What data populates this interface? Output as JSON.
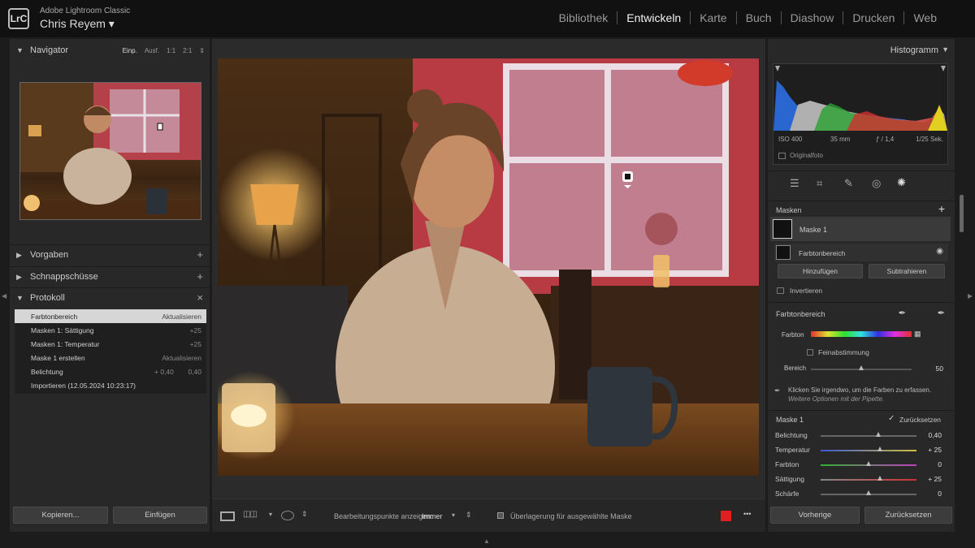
{
  "app": {
    "logo": "LrC",
    "name": "Adobe Lightroom Classic",
    "user": "Chris Reyem ▾"
  },
  "modules": [
    "Bibliothek",
    "Entwickeln",
    "Karte",
    "Buch",
    "Diashow",
    "Drucken",
    "Web"
  ],
  "active_module": "Entwickeln",
  "left": {
    "navigator": {
      "title": "Navigator",
      "zoom": [
        "Einp.",
        "Ausf.",
        "1:1",
        "2:1"
      ],
      "zoom_arrow": "⇕"
    },
    "vorgaben": {
      "title": "Vorgaben",
      "action": "+"
    },
    "schnappschuesse": {
      "title": "Schnappschüsse",
      "action": "+"
    },
    "protokoll": {
      "title": "Protokoll",
      "action": "×",
      "items": [
        {
          "name": "Farbtonbereich",
          "v1": "",
          "v2": "Aktualisieren"
        },
        {
          "name": "Masken 1: Sättigung",
          "v1": "",
          "v2": "+25"
        },
        {
          "name": "Masken 1: Temperatur",
          "v1": "",
          "v2": "+25"
        },
        {
          "name": "Maske 1 erstellen",
          "v1": "",
          "v2": "Aktualisieren"
        },
        {
          "name": "Belichtung",
          "v1": "+ 0,40",
          "v2": "0,40"
        },
        {
          "name": "Importieren (12.05.2024 10:23:17)",
          "v1": "",
          "v2": ""
        }
      ]
    },
    "copy_label": "Kopieren...",
    "paste_label": "Einfügen"
  },
  "toolbar": {
    "edit_points_label": "Bearbeitungspunkte anzeigen:",
    "edit_points_value": "Immer",
    "overlay_label": "Überlagerung für ausgewählte Maske",
    "overlay_color": "#e02020",
    "more": "•••"
  },
  "right": {
    "histogram": {
      "title": "Histogramm",
      "iso": "ISO 400",
      "focal": "35 mm",
      "aperture": "ƒ / 1,4",
      "shutter": "1/25 Sek.",
      "original": "Originalfoto"
    },
    "masks": {
      "title": "Masken",
      "add": "+",
      "mask_name": "Maske 1",
      "component": "Farbtonbereich",
      "add_btn": "Hinzufügen",
      "sub_btn": "Subtrahieren",
      "invert": "Invertieren"
    },
    "farbtonbereich": {
      "title": "Farbtonbereich",
      "farbton_label": "Farbton",
      "fein_label": "Feinabstimmung",
      "bereich_label": "Bereich",
      "bereich_value": "50",
      "bereich_level": 0.5,
      "hint_line1": "Klicken Sie irgendwo, um die Farben zu erfassen.",
      "hint_line2": "Weitere Optionen mit der Pipette."
    },
    "mask1": {
      "title": "Maske 1",
      "reset_label": "Zurücksetzen",
      "sliders": [
        {
          "label": "Belichtung",
          "value": "0,40",
          "level": 0.6
        },
        {
          "label": "Temperatur",
          "value": "+ 25",
          "level": 0.62
        },
        {
          "label": "Farbton",
          "value": "0",
          "level": 0.5
        },
        {
          "label": "Sättigung",
          "value": "+ 25",
          "level": 0.62
        },
        {
          "label": "Schärfe",
          "value": "0",
          "level": 0.5
        }
      ]
    },
    "prev_label": "Vorherige",
    "reset_label": "Zurücksetzen"
  }
}
